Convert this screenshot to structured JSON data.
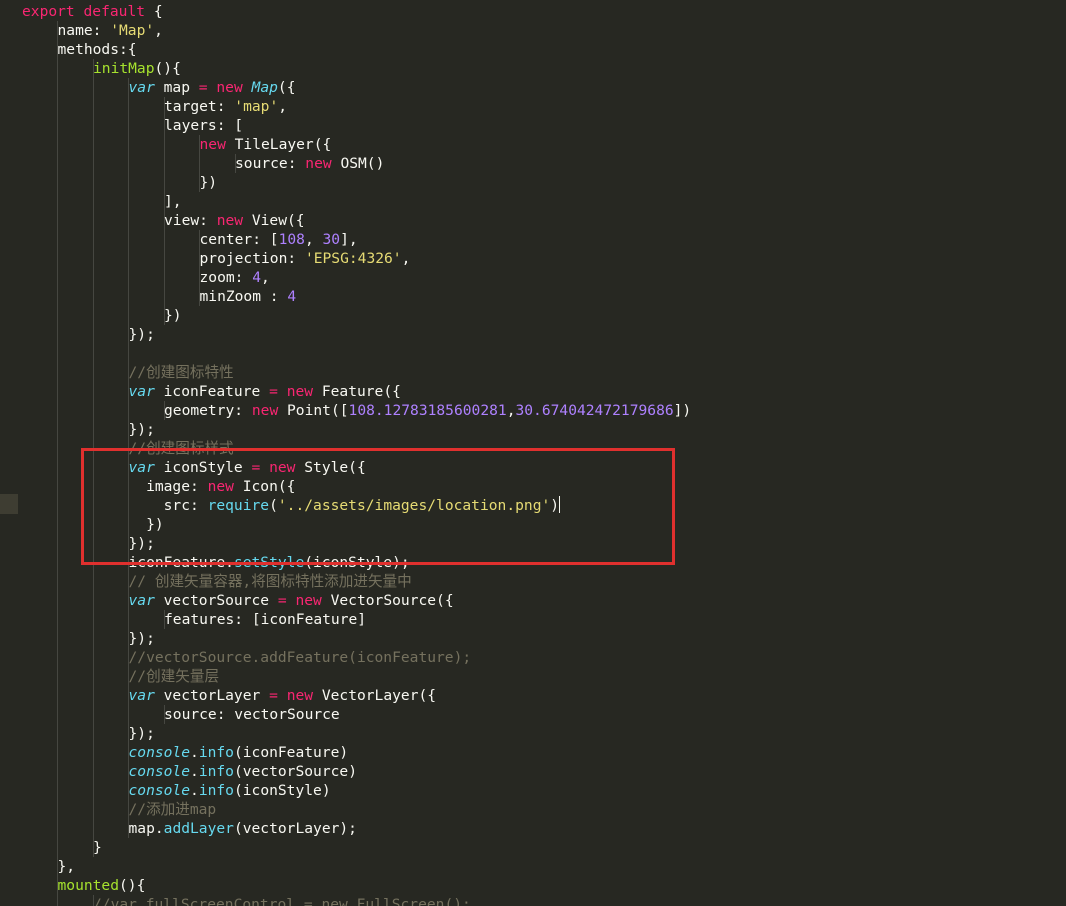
{
  "editor": {
    "colors": {
      "background": "#272822",
      "highlight_box": "#e0302e"
    },
    "lines": [
      {
        "indent": 0,
        "tokens": [
          [
            "keyword",
            "export"
          ],
          [
            "plain",
            " "
          ],
          [
            "keyword",
            "default"
          ],
          [
            "plain",
            " {"
          ]
        ]
      },
      {
        "indent": 1,
        "tokens": [
          [
            "plain",
            "name: "
          ],
          [
            "string",
            "'Map'"
          ],
          [
            "plain",
            ","
          ]
        ]
      },
      {
        "indent": 1,
        "tokens": [
          [
            "plain",
            "methods:{"
          ]
        ]
      },
      {
        "indent": 2,
        "tokens": [
          [
            "func",
            "initMap"
          ],
          [
            "plain",
            "(){"
          ]
        ]
      },
      {
        "indent": 3,
        "tokens": [
          [
            "storage",
            "var"
          ],
          [
            "plain",
            " map "
          ],
          [
            "keyword",
            "="
          ],
          [
            "plain",
            " "
          ],
          [
            "keyword",
            "new"
          ],
          [
            "plain",
            " "
          ],
          [
            "type",
            "Map"
          ],
          [
            "plain",
            "({"
          ]
        ]
      },
      {
        "indent": 4,
        "tokens": [
          [
            "plain",
            "target: "
          ],
          [
            "string",
            "'map'"
          ],
          [
            "plain",
            ","
          ]
        ]
      },
      {
        "indent": 4,
        "tokens": [
          [
            "plain",
            "layers: ["
          ]
        ]
      },
      {
        "indent": 5,
        "tokens": [
          [
            "keyword",
            "new"
          ],
          [
            "plain",
            " TileLayer({"
          ]
        ]
      },
      {
        "indent": 6,
        "tokens": [
          [
            "plain",
            "source: "
          ],
          [
            "keyword",
            "new"
          ],
          [
            "plain",
            " OSM()"
          ]
        ]
      },
      {
        "indent": 5,
        "tokens": [
          [
            "plain",
            "})"
          ]
        ]
      },
      {
        "indent": 4,
        "tokens": [
          [
            "plain",
            "],"
          ]
        ]
      },
      {
        "indent": 4,
        "tokens": [
          [
            "plain",
            "view: "
          ],
          [
            "keyword",
            "new"
          ],
          [
            "plain",
            " View({"
          ]
        ]
      },
      {
        "indent": 5,
        "tokens": [
          [
            "plain",
            "center: ["
          ],
          [
            "number",
            "108"
          ],
          [
            "plain",
            ", "
          ],
          [
            "number",
            "30"
          ],
          [
            "plain",
            "],"
          ]
        ]
      },
      {
        "indent": 5,
        "tokens": [
          [
            "plain",
            "projection: "
          ],
          [
            "string",
            "'EPSG:4326'"
          ],
          [
            "plain",
            ","
          ]
        ]
      },
      {
        "indent": 5,
        "tokens": [
          [
            "plain",
            "zoom: "
          ],
          [
            "number",
            "4"
          ],
          [
            "plain",
            ","
          ]
        ]
      },
      {
        "indent": 5,
        "tokens": [
          [
            "plain",
            "minZoom : "
          ],
          [
            "number",
            "4"
          ]
        ]
      },
      {
        "indent": 4,
        "tokens": [
          [
            "plain",
            "})"
          ]
        ]
      },
      {
        "indent": 3,
        "tokens": [
          [
            "plain",
            "});"
          ]
        ]
      },
      {
        "indent": 3,
        "tokens": []
      },
      {
        "indent": 3,
        "tokens": [
          [
            "comment",
            "//创建图标特性"
          ]
        ]
      },
      {
        "indent": 3,
        "tokens": [
          [
            "storage",
            "var"
          ],
          [
            "plain",
            " iconFeature "
          ],
          [
            "keyword",
            "="
          ],
          [
            "plain",
            " "
          ],
          [
            "keyword",
            "new"
          ],
          [
            "plain",
            " Feature({"
          ]
        ]
      },
      {
        "indent": 4,
        "tokens": [
          [
            "plain",
            "geometry: "
          ],
          [
            "keyword",
            "new"
          ],
          [
            "plain",
            " Point(["
          ],
          [
            "number",
            "108.12783185600281"
          ],
          [
            "plain",
            ","
          ],
          [
            "number",
            "30.674042472179686"
          ],
          [
            "plain",
            "])"
          ]
        ]
      },
      {
        "indent": 3,
        "tokens": [
          [
            "plain",
            "});"
          ]
        ]
      },
      {
        "indent": 3,
        "tokens": [
          [
            "comment",
            "//创建图标样式"
          ]
        ]
      },
      {
        "indent": 3,
        "tokens": [
          [
            "storage",
            "var"
          ],
          [
            "plain",
            " iconStyle "
          ],
          [
            "keyword",
            "="
          ],
          [
            "plain",
            " "
          ],
          [
            "keyword",
            "new"
          ],
          [
            "plain",
            " Style({"
          ]
        ]
      },
      {
        "indent": 3,
        "tokens": [
          [
            "plain",
            "  image: "
          ],
          [
            "keyword",
            "new"
          ],
          [
            "plain",
            " Icon({"
          ]
        ]
      },
      {
        "indent": 3,
        "tokens": [
          [
            "plain",
            "    src: "
          ],
          [
            "method",
            "require"
          ],
          [
            "plain",
            "("
          ],
          [
            "string",
            "'../assets/images/location.png'"
          ],
          [
            "plain",
            ")"
          ],
          [
            "cursor",
            ""
          ]
        ]
      },
      {
        "indent": 3,
        "tokens": [
          [
            "plain",
            "  })"
          ]
        ]
      },
      {
        "indent": 3,
        "tokens": [
          [
            "plain",
            "});"
          ]
        ]
      },
      {
        "indent": 3,
        "tokens": [
          [
            "plain",
            "iconFeature."
          ],
          [
            "method",
            "setStyle"
          ],
          [
            "plain",
            "(iconStyle);"
          ]
        ]
      },
      {
        "indent": 3,
        "tokens": [
          [
            "comment",
            "// 创建矢量容器,将图标特性添加进矢量中"
          ]
        ]
      },
      {
        "indent": 3,
        "tokens": [
          [
            "storage",
            "var"
          ],
          [
            "plain",
            " vectorSource "
          ],
          [
            "keyword",
            "="
          ],
          [
            "plain",
            " "
          ],
          [
            "keyword",
            "new"
          ],
          [
            "plain",
            " VectorSource({"
          ]
        ]
      },
      {
        "indent": 4,
        "tokens": [
          [
            "plain",
            "features: [iconFeature]"
          ]
        ]
      },
      {
        "indent": 3,
        "tokens": [
          [
            "plain",
            "});"
          ]
        ]
      },
      {
        "indent": 3,
        "tokens": [
          [
            "comment",
            "//vectorSource.addFeature(iconFeature);"
          ]
        ]
      },
      {
        "indent": 3,
        "tokens": [
          [
            "comment",
            "//创建矢量层"
          ]
        ]
      },
      {
        "indent": 3,
        "tokens": [
          [
            "storage",
            "var"
          ],
          [
            "plain",
            " vectorLayer "
          ],
          [
            "keyword",
            "="
          ],
          [
            "plain",
            " "
          ],
          [
            "keyword",
            "new"
          ],
          [
            "plain",
            " VectorLayer({"
          ]
        ]
      },
      {
        "indent": 4,
        "tokens": [
          [
            "plain",
            "source: vectorSource"
          ]
        ]
      },
      {
        "indent": 3,
        "tokens": [
          [
            "plain",
            "});"
          ]
        ]
      },
      {
        "indent": 3,
        "tokens": [
          [
            "support",
            "console"
          ],
          [
            "plain",
            "."
          ],
          [
            "method",
            "info"
          ],
          [
            "plain",
            "(iconFeature)"
          ]
        ]
      },
      {
        "indent": 3,
        "tokens": [
          [
            "support",
            "console"
          ],
          [
            "plain",
            "."
          ],
          [
            "method",
            "info"
          ],
          [
            "plain",
            "(vectorSource)"
          ]
        ]
      },
      {
        "indent": 3,
        "tokens": [
          [
            "support",
            "console"
          ],
          [
            "plain",
            "."
          ],
          [
            "method",
            "info"
          ],
          [
            "plain",
            "(iconStyle)"
          ]
        ]
      },
      {
        "indent": 3,
        "tokens": [
          [
            "comment",
            "//添加进map"
          ]
        ]
      },
      {
        "indent": 3,
        "tokens": [
          [
            "plain",
            "map."
          ],
          [
            "method",
            "addLayer"
          ],
          [
            "plain",
            "(vectorLayer);"
          ]
        ]
      },
      {
        "indent": 2,
        "tokens": [
          [
            "plain",
            "}"
          ]
        ]
      },
      {
        "indent": 1,
        "tokens": [
          [
            "plain",
            "},"
          ]
        ]
      },
      {
        "indent": 1,
        "tokens": [
          [
            "func",
            "mounted"
          ],
          [
            "plain",
            "(){"
          ]
        ]
      },
      {
        "indent": 2,
        "tokens": [
          [
            "comment",
            "//var fullScreenControl = new FullScreen();"
          ]
        ]
      }
    ]
  }
}
